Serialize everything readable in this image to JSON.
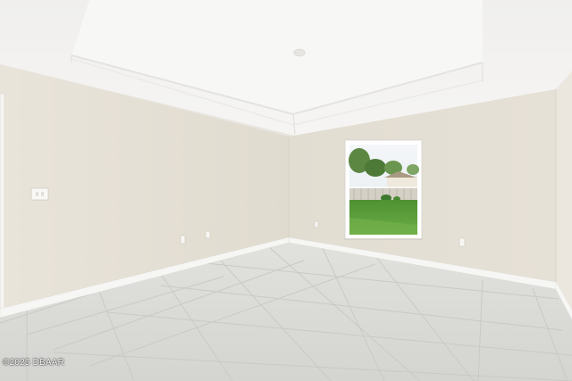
{
  "photo": {
    "watermark_text": "©2025 DBAAR"
  },
  "palette": {
    "ceiling": "#f3f2f0",
    "tray_ceiling": "#f7f7f6",
    "wall_left": "#e6e1d6",
    "wall_back": "#e3ded3",
    "wall_right": "#ebe7df",
    "baseboard": "#f6f6f4",
    "floor": "#d9d9d6",
    "grout": "#c6c6c2",
    "window_frame": "#ffffff",
    "sky": "#eef2f5",
    "lawn": "#5a9a3a",
    "trees": "#4f7a3c"
  }
}
